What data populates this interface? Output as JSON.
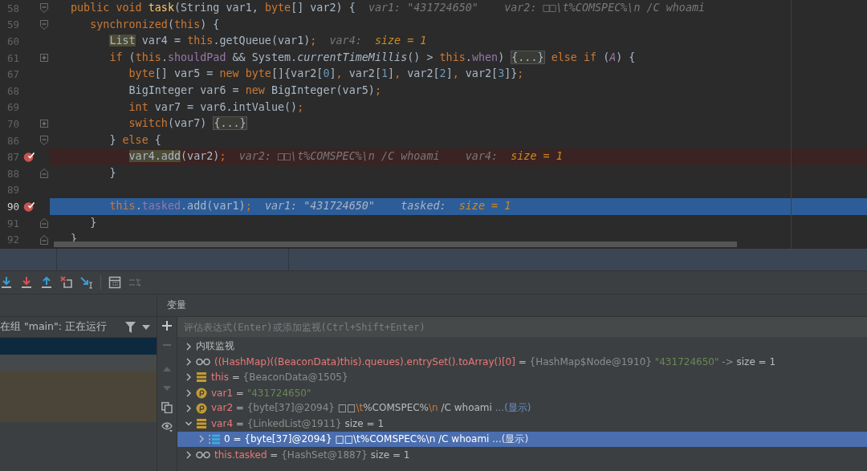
{
  "editor": {
    "lines": [
      {
        "number": "58",
        "kind": "normal",
        "fold_start": true,
        "fold_end": false,
        "collapsed": false,
        "breakpoint": false,
        "tokens": [
          {
            "text": "public void ",
            "kind": "kw"
          },
          {
            "text": "task",
            "kind": "decl"
          },
          {
            "text": "(String var1, ",
            "kind": "pl"
          },
          {
            "text": "byte",
            "kind": "kw"
          },
          {
            "text": "[] var2) {",
            "kind": "pl"
          },
          {
            "text": "  var1: \"431724650\"    var2: □□\\t%COMSPEC%\\n /C whoami",
            "kind": "hint"
          }
        ]
      },
      {
        "number": "59",
        "kind": "normal",
        "fold_start": true,
        "fold_end": false,
        "collapsed": false,
        "breakpoint": false,
        "tokens": [
          {
            "text": "   synchronized",
            "kind": "kw"
          },
          {
            "text": "(",
            "kind": "pl"
          },
          {
            "text": "this",
            "kind": "kw"
          },
          {
            "text": ") {",
            "kind": "pl"
          }
        ]
      },
      {
        "number": "60",
        "kind": "normal",
        "fold_start": false,
        "fold_end": false,
        "collapsed": false,
        "breakpoint": false,
        "tokens": [
          {
            "text": "      List",
            "kind": "usage"
          },
          {
            "text": " var4 = ",
            "kind": "pl"
          },
          {
            "text": "this",
            "kind": "kw"
          },
          {
            "text": ".getQueue(var1)",
            "kind": "pl"
          },
          {
            "text": ";",
            "kind": "kw"
          },
          {
            "text": "  var4:  ",
            "kind": "hint"
          },
          {
            "text": "size = 1",
            "kind": "hintv"
          }
        ]
      },
      {
        "number": "61",
        "kind": "normal",
        "fold_start": false,
        "fold_end": false,
        "collapsed": true,
        "breakpoint": false,
        "tokens": [
          {
            "text": "      if ",
            "kind": "kw"
          },
          {
            "text": "(",
            "kind": "pl"
          },
          {
            "text": "this",
            "kind": "kw"
          },
          {
            "text": ".",
            "kind": "pl"
          },
          {
            "text": "shouldPad",
            "kind": "fld"
          },
          {
            "text": " && System.",
            "kind": "pl"
          },
          {
            "text": "currentTimeMillis",
            "kind": "ital"
          },
          {
            "text": "() > ",
            "kind": "pl"
          },
          {
            "text": "this",
            "kind": "kw"
          },
          {
            "text": ".",
            "kind": "pl"
          },
          {
            "text": "when",
            "kind": "fld"
          },
          {
            "text": ") ",
            "kind": "pl"
          },
          {
            "text": "{...}",
            "kind": "folded"
          },
          {
            "text": " else if ",
            "kind": "kw"
          },
          {
            "text": "(",
            "kind": "pl"
          },
          {
            "text": "A",
            "kind": "fldi"
          },
          {
            "text": ") {",
            "kind": "pl"
          }
        ]
      },
      {
        "number": "67",
        "kind": "normal",
        "fold_start": false,
        "fold_end": false,
        "collapsed": false,
        "breakpoint": false,
        "tokens": [
          {
            "text": "         byte",
            "kind": "kw"
          },
          {
            "text": "[] var5 = ",
            "kind": "pl"
          },
          {
            "text": "new byte",
            "kind": "kw"
          },
          {
            "text": "[]{var2[",
            "kind": "pl"
          },
          {
            "text": "0",
            "kind": "num"
          },
          {
            "text": "]",
            "kind": "pl"
          },
          {
            "text": ", ",
            "kind": "kw"
          },
          {
            "text": "var2[",
            "kind": "pl"
          },
          {
            "text": "1",
            "kind": "num"
          },
          {
            "text": "]",
            "kind": "pl"
          },
          {
            "text": ", ",
            "kind": "kw"
          },
          {
            "text": "var2[",
            "kind": "pl"
          },
          {
            "text": "2",
            "kind": "num"
          },
          {
            "text": "]",
            "kind": "pl"
          },
          {
            "text": ", ",
            "kind": "kw"
          },
          {
            "text": "var2[",
            "kind": "pl"
          },
          {
            "text": "3",
            "kind": "num"
          },
          {
            "text": "]}",
            "kind": "pl"
          },
          {
            "text": ";",
            "kind": "kw"
          }
        ]
      },
      {
        "number": "68",
        "kind": "normal",
        "fold_start": false,
        "fold_end": false,
        "collapsed": false,
        "breakpoint": false,
        "tokens": [
          {
            "text": "         BigInteger var6 = ",
            "kind": "pl"
          },
          {
            "text": "new ",
            "kind": "kw"
          },
          {
            "text": "BigInteger(var5)",
            "kind": "pl"
          },
          {
            "text": ";",
            "kind": "kw"
          }
        ]
      },
      {
        "number": "69",
        "kind": "normal",
        "fold_start": false,
        "fold_end": false,
        "collapsed": false,
        "breakpoint": false,
        "tokens": [
          {
            "text": "         int ",
            "kind": "kw"
          },
          {
            "text": "var7 = var6.intValue()",
            "kind": "pl"
          },
          {
            "text": ";",
            "kind": "kw"
          }
        ]
      },
      {
        "number": "70",
        "kind": "normal",
        "fold_start": false,
        "fold_end": false,
        "collapsed": true,
        "breakpoint": false,
        "tokens": [
          {
            "text": "         switch",
            "kind": "kw"
          },
          {
            "text": "(var7) ",
            "kind": "pl"
          },
          {
            "text": "{...}",
            "kind": "folded"
          }
        ]
      },
      {
        "number": "86",
        "kind": "normal",
        "fold_start": true,
        "fold_end": false,
        "collapsed": false,
        "breakpoint": false,
        "tokens": [
          {
            "text": "      } ",
            "kind": "pl"
          },
          {
            "text": "else ",
            "kind": "kw"
          },
          {
            "text": "{",
            "kind": "pl"
          }
        ]
      },
      {
        "number": "87",
        "kind": "breakpoint",
        "fold_start": false,
        "fold_end": false,
        "collapsed": false,
        "breakpoint": true,
        "tokens": [
          {
            "text": "         var4.add",
            "kind": "usage"
          },
          {
            "text": "(var2)",
            "kind": "pl"
          },
          {
            "text": ";",
            "kind": "kw"
          },
          {
            "text": "  var2: □□\\t%COMSPEC%\\n /C whoami    var4:  ",
            "kind": "hint"
          },
          {
            "text": "size = 1",
            "kind": "hintv"
          }
        ]
      },
      {
        "number": "88",
        "kind": "normal",
        "fold_start": false,
        "fold_end": true,
        "collapsed": false,
        "breakpoint": false,
        "tokens": [
          {
            "text": "      }",
            "kind": "pl"
          }
        ]
      },
      {
        "number": "89",
        "kind": "normal",
        "fold_start": false,
        "fold_end": false,
        "collapsed": false,
        "breakpoint": false
      },
      {
        "number": "90",
        "kind": "execution",
        "fold_start": false,
        "fold_end": false,
        "collapsed": false,
        "breakpoint": true,
        "tokens": [
          {
            "text": "      this",
            "kind": "kw"
          },
          {
            "text": ".",
            "kind": "pl"
          },
          {
            "text": "tasked",
            "kind": "fld"
          },
          {
            "text": ".add(var1)",
            "kind": "pl"
          },
          {
            "text": ";",
            "kind": "kw"
          },
          {
            "text": "  var1: \"431724650\"    tasked:  ",
            "kind": "hint"
          },
          {
            "text": "size = 1",
            "kind": "hintv"
          }
        ]
      },
      {
        "number": "91",
        "kind": "normal",
        "fold_start": false,
        "fold_end": true,
        "collapsed": false,
        "breakpoint": false,
        "tokens": [
          {
            "text": "   }",
            "kind": "pl"
          }
        ]
      },
      {
        "number": "92",
        "kind": "normal",
        "fold_start": false,
        "fold_end": true,
        "collapsed": false,
        "breakpoint": false,
        "tokens": [
          {
            "text": "}",
            "kind": "pl"
          }
        ]
      }
    ]
  },
  "frames_panel": {
    "thread_selector": "在组 \"main\": 正在运行",
    "frames": [
      {
        "selected": true,
        "kind": "normal"
      },
      {
        "selected": false,
        "kind": "normal"
      },
      {
        "selected": false,
        "kind": "library"
      },
      {
        "selected": false,
        "kind": "library"
      },
      {
        "selected": false,
        "kind": "library"
      }
    ]
  },
  "variables_panel": {
    "title": "变量",
    "evaluate_field": {
      "placeholder": "评估表达式(Enter)或添加监视(Ctrl+Shift+Enter)"
    },
    "rows": [
      {
        "kind": "group",
        "expanded": false,
        "selected": false,
        "segments": [
          {
            "text": "内联监视",
            "kind": "plain"
          }
        ]
      },
      {
        "kind": "watch",
        "expanded": false,
        "selected": false,
        "segments": [
          {
            "text": "((HashMap)((BeaconData)this).queues).entrySet().toArray()[0]",
            "kind": "name"
          },
          {
            "text": " = ",
            "kind": "eq"
          },
          {
            "text": "{HashMap$Node@1910} ",
            "kind": "type"
          },
          {
            "text": "\"431724650\"",
            "kind": "str"
          },
          {
            "text": " ->  ",
            "kind": "type"
          },
          {
            "text": "size = 1",
            "kind": "plain"
          }
        ]
      },
      {
        "kind": "field",
        "expanded": false,
        "selected": false,
        "segments": [
          {
            "text": "this",
            "kind": "name"
          },
          {
            "text": " = ",
            "kind": "eq"
          },
          {
            "text": "{BeaconData@1505}",
            "kind": "type"
          }
        ]
      },
      {
        "kind": "param",
        "expanded": false,
        "selected": false,
        "segments": [
          {
            "text": "var1",
            "kind": "name"
          },
          {
            "text": " = ",
            "kind": "eq"
          },
          {
            "text": "\"431724650\"",
            "kind": "str"
          }
        ]
      },
      {
        "kind": "param",
        "expanded": false,
        "selected": false,
        "segments": [
          {
            "text": "var2",
            "kind": "name"
          },
          {
            "text": " = ",
            "kind": "eq"
          },
          {
            "text": "{byte[37]@2094} ",
            "kind": "type"
          },
          {
            "text": "□□",
            "kind": "plain"
          },
          {
            "text": "\\t",
            "kind": "esc"
          },
          {
            "text": "%COMSPEC%",
            "kind": "plain"
          },
          {
            "text": "\\n",
            "kind": "esc"
          },
          {
            "text": " /C whoami ",
            "kind": "plain"
          },
          {
            "text": "...(显示)",
            "kind": "link"
          }
        ]
      },
      {
        "kind": "field",
        "expanded": true,
        "selected": false,
        "segments": [
          {
            "text": "var4",
            "kind": "name"
          },
          {
            "text": " = ",
            "kind": "eq"
          },
          {
            "text": "{LinkedList@1911}",
            "kind": "type"
          },
          {
            "text": "  size = 1",
            "kind": "plain"
          }
        ],
        "children": [
          {
            "kind": "element",
            "expanded": false,
            "selected": true,
            "segments": [
              {
                "text": "0",
                "kind": "name"
              },
              {
                "text": " = ",
                "kind": "eq"
              },
              {
                "text": "{byte[37]@2094} ",
                "kind": "type"
              },
              {
                "text": "□□\\t%COMSPEC%\\n /C whoami ",
                "kind": "plain"
              },
              {
                "text": "...(显示)",
                "kind": "link"
              }
            ]
          }
        ]
      },
      {
        "kind": "watch",
        "expanded": false,
        "selected": false,
        "segments": [
          {
            "text": "this.tasked",
            "kind": "name"
          },
          {
            "text": " = ",
            "kind": "eq"
          },
          {
            "text": "{HashSet@1887}",
            "kind": "type"
          },
          {
            "text": "  size = 1",
            "kind": "plain"
          }
        ]
      }
    ]
  }
}
